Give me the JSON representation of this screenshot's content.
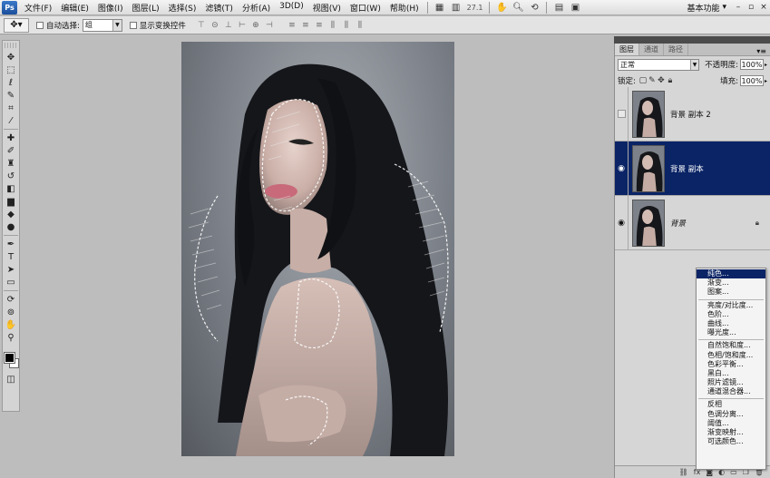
{
  "app": {
    "logo": "Ps"
  },
  "menubar": {
    "items": [
      "文件(F)",
      "编辑(E)",
      "图像(I)",
      "图层(L)",
      "选择(S)",
      "滤镜(T)",
      "分析(A)",
      "3D(D)",
      "视图(V)",
      "窗口(W)",
      "帮助(H)"
    ],
    "zoom": "27.1",
    "workspace": "基本功能"
  },
  "options": {
    "auto_select_label": "自动选择:",
    "auto_select_value": "组",
    "show_transform_label": "显示变换控件"
  },
  "layers_panel": {
    "tabs": [
      "图层",
      "通道",
      "路径"
    ],
    "active_tab": 0,
    "blend_mode": "正常",
    "opacity_label": "不透明度:",
    "opacity_value": "100%",
    "lock_label": "锁定:",
    "fill_label": "填充:",
    "fill_value": "100%",
    "layers": [
      {
        "name": "背景 副本 2",
        "visible": false,
        "selected": false
      },
      {
        "name": "背景 副本",
        "visible": true,
        "selected": true
      },
      {
        "name": "背景",
        "visible": true,
        "selected": false,
        "locked": true
      }
    ],
    "bottom_icons": [
      "link-icon",
      "fx-icon",
      "mask-icon",
      "adjustment-icon"
    ]
  },
  "adjustment_menu": {
    "groups": [
      [
        "纯色...",
        "渐变...",
        "图案..."
      ],
      [
        "亮度/对比度...",
        "色阶...",
        "曲线...",
        "曝光度..."
      ],
      [
        "自然饱和度...",
        "色相/饱和度...",
        "色彩平衡...",
        "黑白...",
        "照片滤镜...",
        "通道混合器..."
      ],
      [
        "反相",
        "色调分离...",
        "阈值...",
        "渐变映射...",
        "可选颜色..."
      ]
    ],
    "highlighted": "纯色..."
  },
  "colors": {
    "selection_blue": "#0a2466",
    "foreground": "#000000",
    "background": "#ffffff"
  }
}
